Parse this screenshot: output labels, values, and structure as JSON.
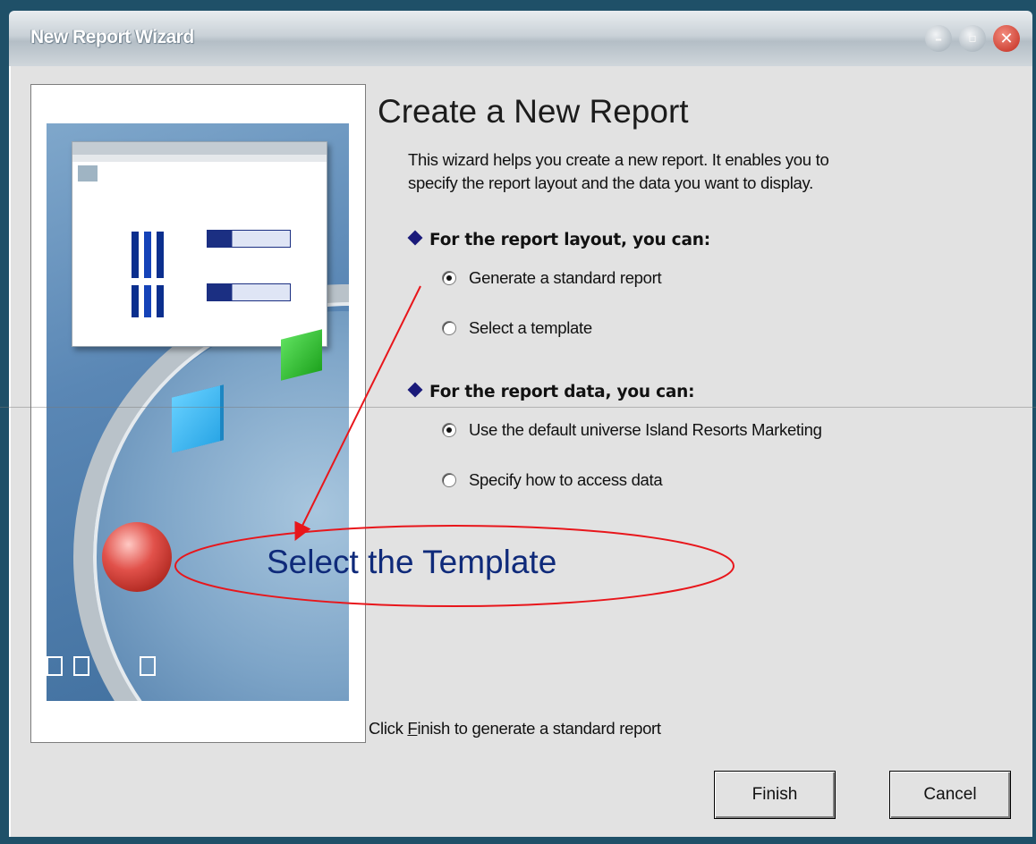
{
  "window": {
    "title": "New Report Wizard",
    "controls": {
      "minimize": "–",
      "maximize": "▫",
      "close": "✕"
    }
  },
  "wizard": {
    "heading": "Create a New Report",
    "intro_line1": "This wizard helps you create a new report. It enables you to",
    "intro_line2": "specify the report layout and the data you want to display.",
    "layout_section": {
      "label": "For the report layout, you can:",
      "options": [
        {
          "label": "Generate a standard report",
          "selected": true
        },
        {
          "label": "Select a template",
          "selected": false
        }
      ]
    },
    "data_section": {
      "label": "For the report data, you can:",
      "options": [
        {
          "label": "Use the default universe Island Resorts Marketing",
          "selected": true
        },
        {
          "label": "Specify how to access data",
          "selected": false
        }
      ]
    },
    "status_prefix": "Click ",
    "status_mnemonic": "F",
    "status_rest": "inish to generate a standard report",
    "buttons": {
      "finish": "Finish",
      "cancel": "Cancel"
    }
  },
  "annotation": {
    "text": "Select the Template",
    "color": "#e8161b",
    "text_color": "#0f2a7a"
  },
  "colors": {
    "desktop": "#1d4f66",
    "dialog_bg": "#e2e2e2",
    "diamond": "#1a1a7a"
  }
}
